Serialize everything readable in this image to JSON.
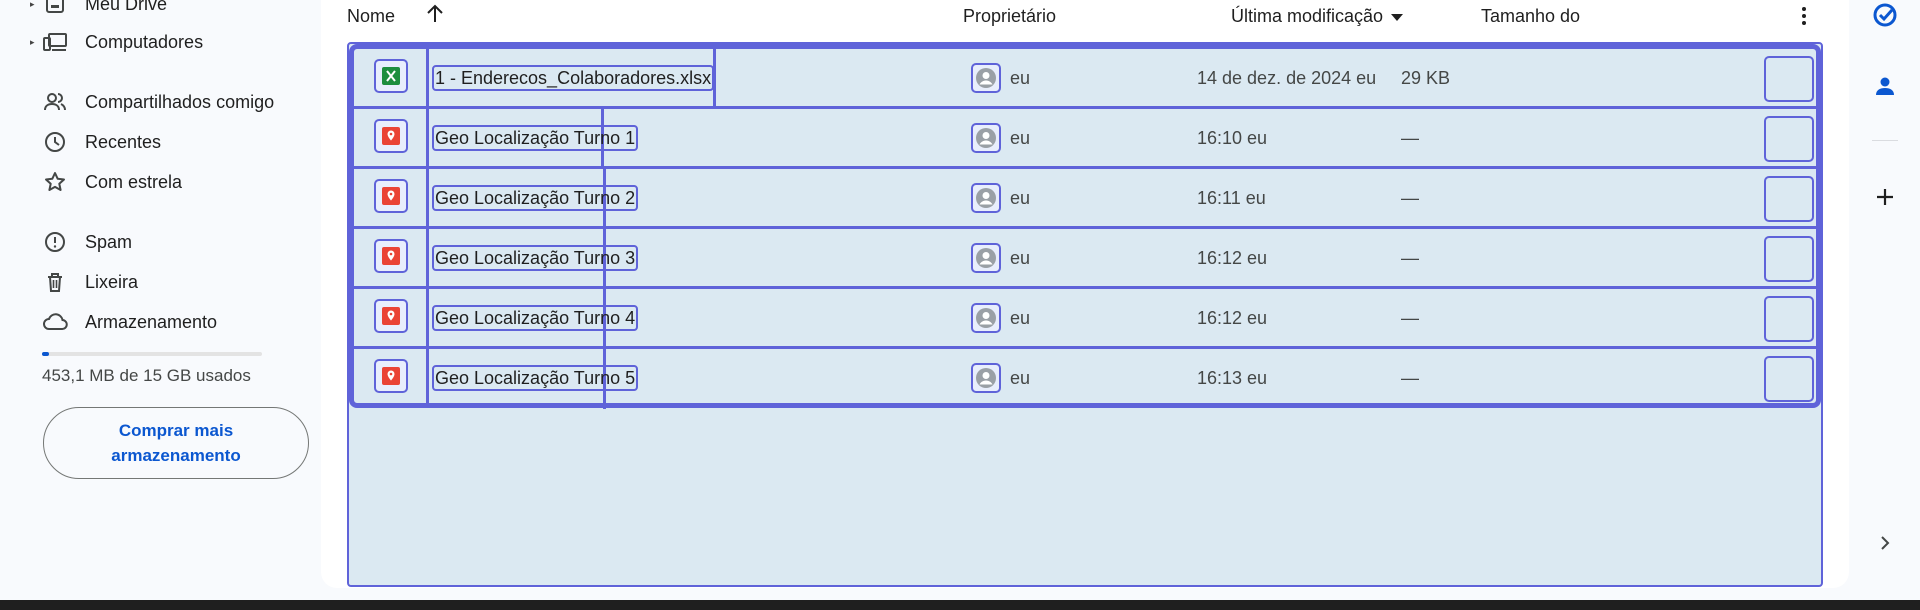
{
  "sidebar": {
    "items": [
      {
        "label": "Meu Drive",
        "icon": "my-drive-icon"
      },
      {
        "label": "Computadores",
        "icon": "computer-icon"
      },
      {
        "label": "Compartilhados comigo",
        "icon": "people-icon"
      },
      {
        "label": "Recentes",
        "icon": "clock-icon"
      },
      {
        "label": "Com estrela",
        "icon": "star-icon"
      },
      {
        "label": "Spam",
        "icon": "spam-icon"
      },
      {
        "label": "Lixeira",
        "icon": "trash-icon"
      },
      {
        "label": "Armazenamento",
        "icon": "cloud-icon"
      }
    ],
    "storage": {
      "used_text": "453,1 MB de 15 GB usados",
      "fraction": 0.03
    },
    "buy_button": "Comprar mais armazenamento"
  },
  "table": {
    "headers": {
      "name": "Nome",
      "owner": "Proprietário",
      "modified": "Última modificação",
      "size": "Tamanho do"
    },
    "rows": [
      {
        "name": "1 - Enderecos_Colaboradores.xlsx",
        "type": "xlsx",
        "owner": "eu",
        "modified": "14 de dez. de 2024 eu",
        "size": "29 KB"
      },
      {
        "name": "Geo Localização Turno 1",
        "type": "map",
        "owner": "eu",
        "modified": "16:10 eu",
        "size": "—"
      },
      {
        "name": "Geo Localização Turno 2",
        "type": "map",
        "owner": "eu",
        "modified": "16:11 eu",
        "size": "—"
      },
      {
        "name": "Geo Localização Turno 3",
        "type": "map",
        "owner": "eu",
        "modified": "16:12 eu",
        "size": "—"
      },
      {
        "name": "Geo Localização Turno 4",
        "type": "map",
        "owner": "eu",
        "modified": "16:12 eu",
        "size": "—"
      },
      {
        "name": "Geo Localização Turno 5",
        "type": "map",
        "owner": "eu",
        "modified": "16:13 eu",
        "size": "—"
      }
    ]
  },
  "colors": {
    "accent": "#0b57d0",
    "highlight": "#5f63d9",
    "row_bg": "#dbe9f2",
    "xlsx_green": "#1e8e3e",
    "map_red": "#ea4335"
  }
}
